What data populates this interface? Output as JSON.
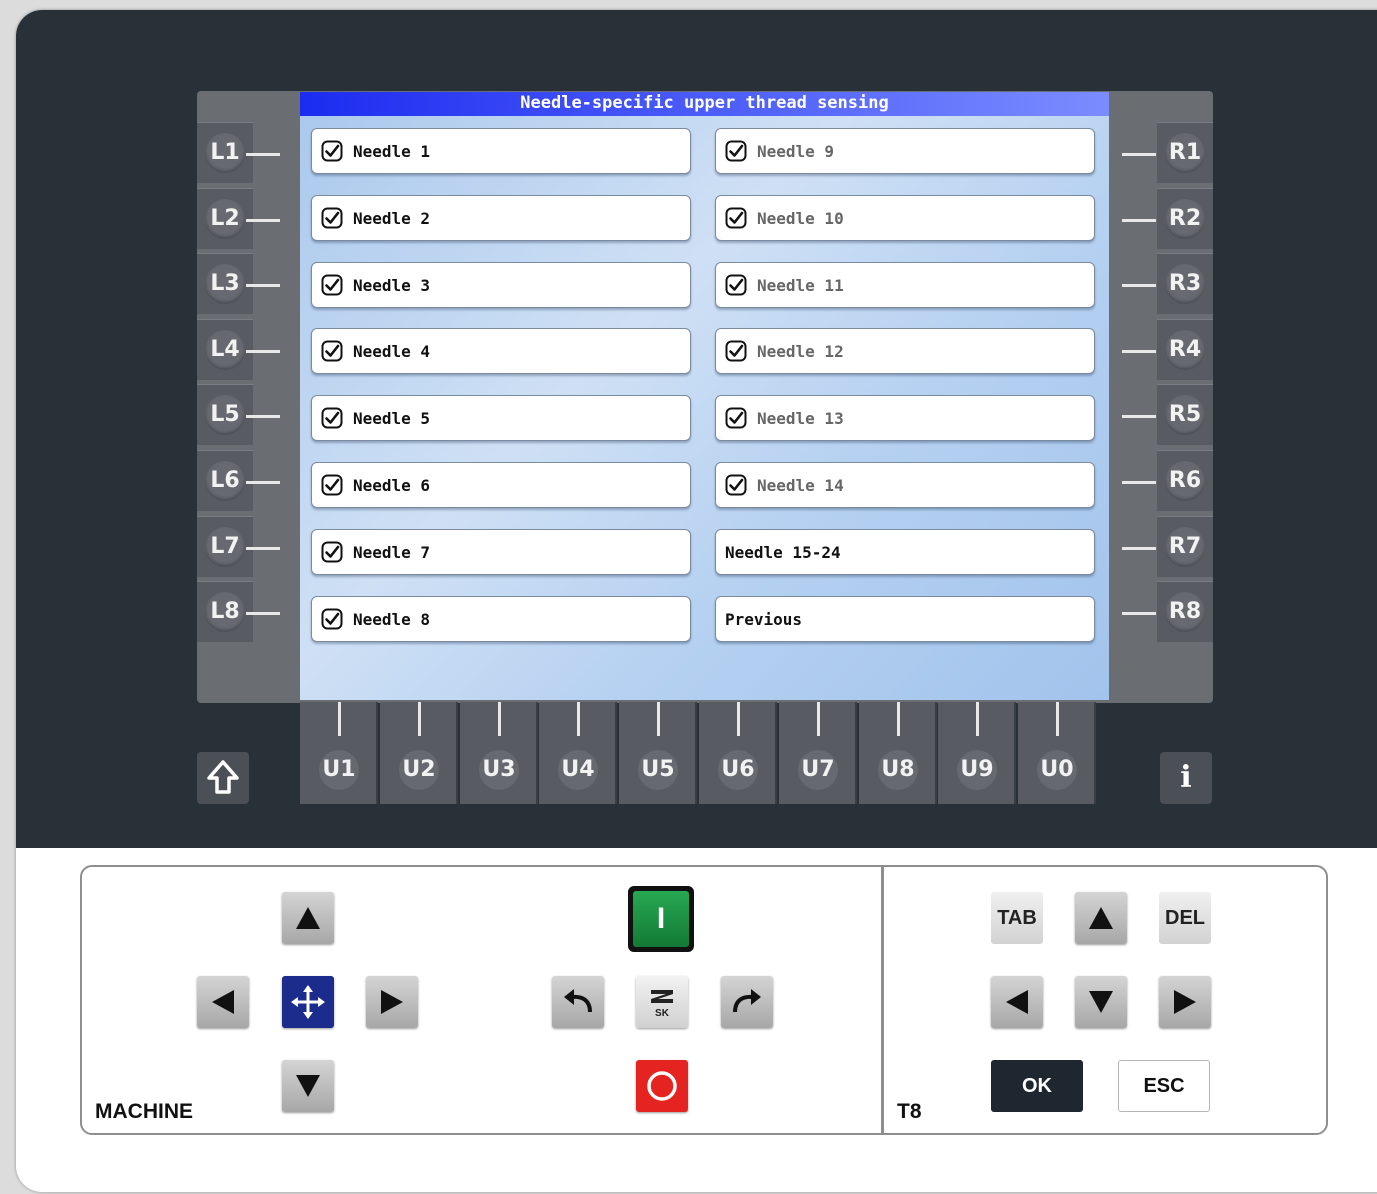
{
  "screen": {
    "title": "Needle-specific upper thread sensing",
    "left_items": [
      {
        "label": "Needle 1",
        "checked": true
      },
      {
        "label": "Needle 2",
        "checked": true
      },
      {
        "label": "Needle 3",
        "checked": true
      },
      {
        "label": "Needle 4",
        "checked": true
      },
      {
        "label": "Needle 5",
        "checked": true
      },
      {
        "label": "Needle 6",
        "checked": true
      },
      {
        "label": "Needle 7",
        "checked": true
      },
      {
        "label": "Needle 8",
        "checked": true
      }
    ],
    "right_items": [
      {
        "label": "Needle 9",
        "checked": true
      },
      {
        "label": "Needle 10",
        "checked": true
      },
      {
        "label": "Needle 11",
        "checked": true
      },
      {
        "label": "Needle 12",
        "checked": true
      },
      {
        "label": "Needle 13",
        "checked": true
      },
      {
        "label": "Needle 14",
        "checked": true
      },
      {
        "label": "Needle 15-24"
      },
      {
        "label": "Previous"
      }
    ]
  },
  "left_keys": [
    "L1",
    "L2",
    "L3",
    "L4",
    "L5",
    "L6",
    "L7",
    "L8"
  ],
  "right_keys": [
    "R1",
    "R2",
    "R3",
    "R4",
    "R5",
    "R6",
    "R7",
    "R8"
  ],
  "bottom_keys": [
    "U1",
    "U2",
    "U3",
    "U4",
    "U5",
    "U6",
    "U7",
    "U8",
    "U9",
    "U0"
  ],
  "shift_icon": "shift-arrow-icon",
  "info_label": "i",
  "machine_panel": {
    "caption": "MACHINE",
    "start_label": "I",
    "logo_label": "ZSK"
  },
  "t8_panel": {
    "caption": "T8",
    "tab_label": "TAB",
    "del_label": "DEL",
    "ok_label": "OK",
    "esc_label": "ESC"
  },
  "colors": {
    "start_green": "#1a8a3e",
    "stop_red": "#e52421",
    "move_blue": "#1c2c8c",
    "title_blue": "#1c2cf0"
  }
}
